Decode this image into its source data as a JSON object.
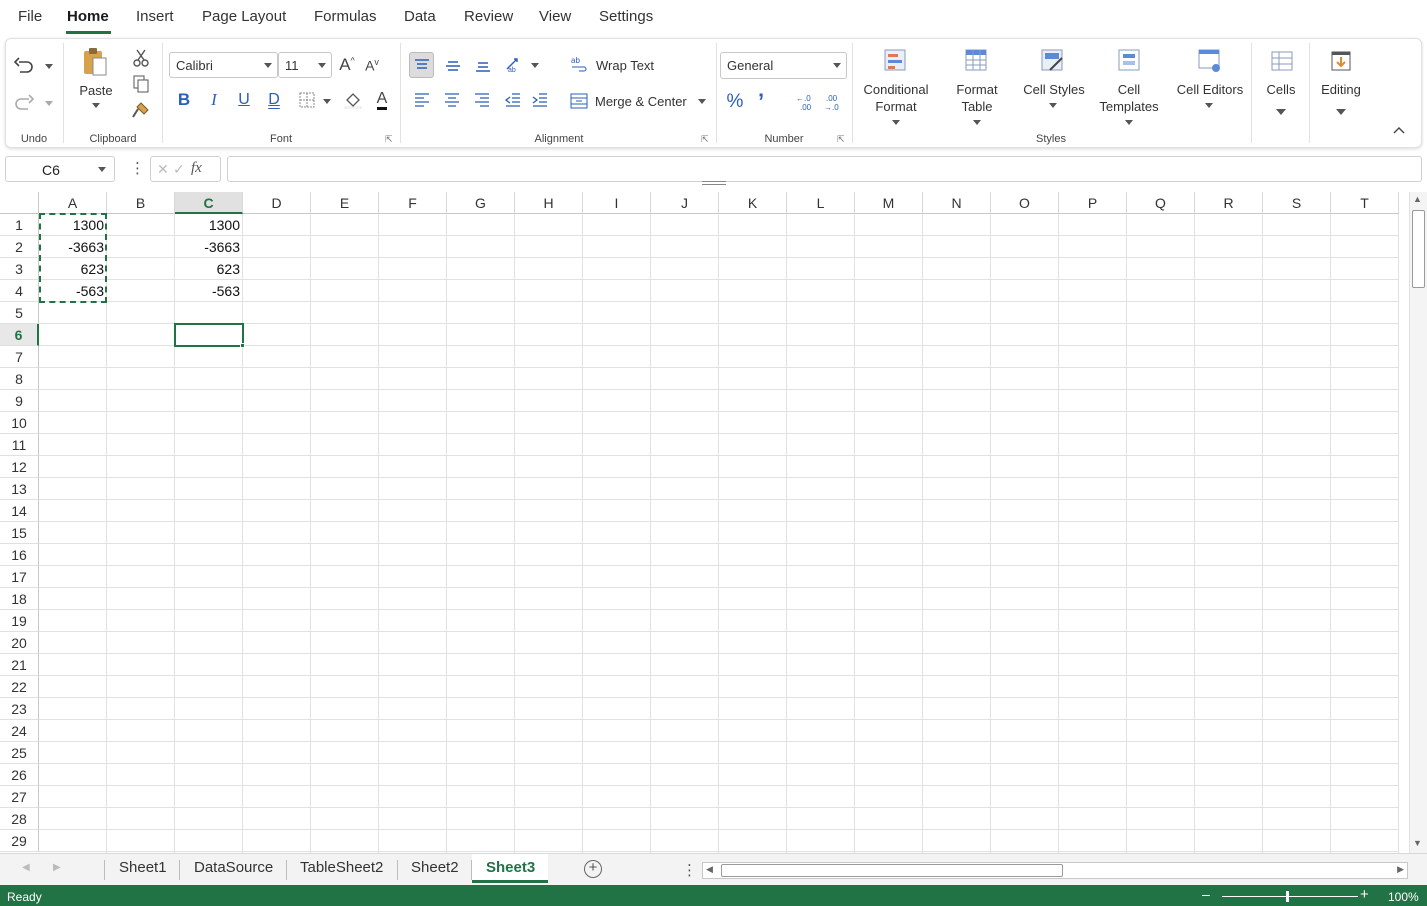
{
  "menu": {
    "items": [
      "File",
      "Home",
      "Insert",
      "Page Layout",
      "Formulas",
      "Data",
      "Review",
      "View",
      "Settings"
    ],
    "active": "Home"
  },
  "ribbon": {
    "undo_group_label": "Undo",
    "clipboard": {
      "paste_label": "Paste",
      "group_label": "Clipboard"
    },
    "font": {
      "family": "Calibri",
      "size": "11",
      "group_label": "Font"
    },
    "alignment": {
      "wrap_text": "Wrap Text",
      "merge_center": "Merge & Center",
      "group_label": "Alignment"
    },
    "number": {
      "format": "General",
      "group_label": "Number"
    },
    "styles": {
      "conditional_format": [
        "Conditional",
        "Format"
      ],
      "format_table": [
        "Format",
        "Table"
      ],
      "cell_styles": "Cell Styles",
      "cell_templates": [
        "Cell",
        "Templates"
      ],
      "cell_editors": "Cell Editors",
      "group_label": "Styles"
    },
    "cells_label": "Cells",
    "editing_label": "Editing"
  },
  "formula_bar": {
    "name_box": "C6",
    "fx": "fx",
    "formula": ""
  },
  "grid": {
    "columns": [
      "A",
      "B",
      "C",
      "D",
      "E",
      "F",
      "G",
      "H",
      "I",
      "J",
      "K",
      "L",
      "M",
      "N",
      "O",
      "P",
      "Q",
      "R",
      "S",
      "T"
    ],
    "rows": [
      "1",
      "2",
      "3",
      "4",
      "5",
      "6",
      "7",
      "8",
      "9",
      "10",
      "11",
      "12",
      "13",
      "14",
      "15",
      "16",
      "17",
      "18",
      "19",
      "20",
      "21",
      "22",
      "23",
      "24",
      "25",
      "26",
      "27",
      "28",
      "29"
    ],
    "selected_column": "C",
    "selected_row": "6",
    "cells": {
      "A1": "1300",
      "A2": "-3663",
      "A3": "623",
      "A4": "-563",
      "C1": "1300",
      "C2": "-3663",
      "C3": "623",
      "C4": "-563"
    }
  },
  "sheets": {
    "tabs": [
      "Sheet1",
      "DataSource",
      "TableSheet2",
      "Sheet2",
      "Sheet3"
    ],
    "active": "Sheet3"
  },
  "status": {
    "text": "Ready",
    "zoom": "100%"
  },
  "colors": {
    "accent": "#217346"
  }
}
